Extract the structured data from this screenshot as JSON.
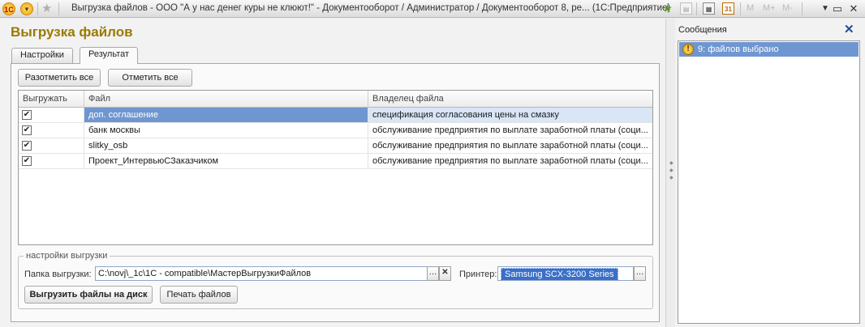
{
  "window": {
    "title": "Выгрузка файлов - ООО \"А у нас денег куры  не клюют!\" - Документооборот / Администратор /  Документооборот 8, ре...  (1С:Предприятие)",
    "logo": "1С",
    "memory_buttons": [
      "M",
      "M+",
      "M-"
    ]
  },
  "form": {
    "title": "Выгрузка файлов",
    "tabs": [
      {
        "label": "Настройки",
        "active": false
      },
      {
        "label": "Результат",
        "active": true
      }
    ],
    "buttons": {
      "unmark_all": "Разотметить все",
      "mark_all": "Отметить все"
    },
    "table": {
      "columns": [
        "Выгружать",
        "Файл",
        "Владелец файла"
      ],
      "rows": [
        {
          "checked": true,
          "file": "доп. соглашение",
          "owner": "спецификация согласования цены на смазку",
          "selected": true
        },
        {
          "checked": true,
          "file": "банк москвы",
          "owner": "обслуживание предприятия по выплате заработной платы (соци...",
          "selected": false
        },
        {
          "checked": true,
          "file": "slitky_osb",
          "owner": "обслуживание предприятия по выплате заработной платы (соци...",
          "selected": false
        },
        {
          "checked": true,
          "file": "Проект_ИнтервьюСЗаказчиком",
          "owner": "обслуживание предприятия по выплате заработной платы (соци...",
          "selected": false
        }
      ]
    },
    "settings": {
      "group_title": "настройки выгрузки",
      "folder_label": "Папка выгрузки:",
      "folder_value": "C:\\novj\\_1c\\1C - compatible\\МастерВыгрузкиФайлов",
      "printer_label": "Принтер:",
      "printer_value": "Samsung SCX-3200 Series",
      "export_button": "Выгрузить файлы на диск",
      "print_button": "Печать файлов"
    }
  },
  "messages": {
    "title": "Сообщения",
    "items": [
      {
        "text": "9: файлов выбрано",
        "icon": "warning-icon"
      }
    ]
  },
  "colors": {
    "title_accent": "#9a7a00",
    "selection": "#6f96d0",
    "close_icon": "#1f4e9a"
  }
}
